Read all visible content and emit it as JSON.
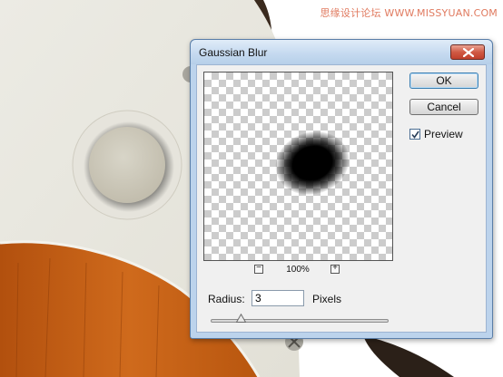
{
  "watermark": "思缘设计论坛  WWW.MISSYUAN.COM",
  "dialog": {
    "title": "Gaussian Blur",
    "close_icon": "close-icon",
    "ok_label": "OK",
    "cancel_label": "Cancel",
    "preview": {
      "label": "Preview",
      "checked": true
    },
    "zoom": {
      "level": "100%",
      "minus_label": "−",
      "plus_label": "+"
    },
    "radius": {
      "label": "Radius:",
      "value": "3",
      "unit": "Pixels",
      "slider_fraction": 0.17
    }
  },
  "colors": {
    "guitar_body": "#e9e8e0",
    "wood": "#c45c12",
    "knob": "#cfcbbe",
    "title_bar": "#c6daf0",
    "close_button": "#d05a44"
  }
}
